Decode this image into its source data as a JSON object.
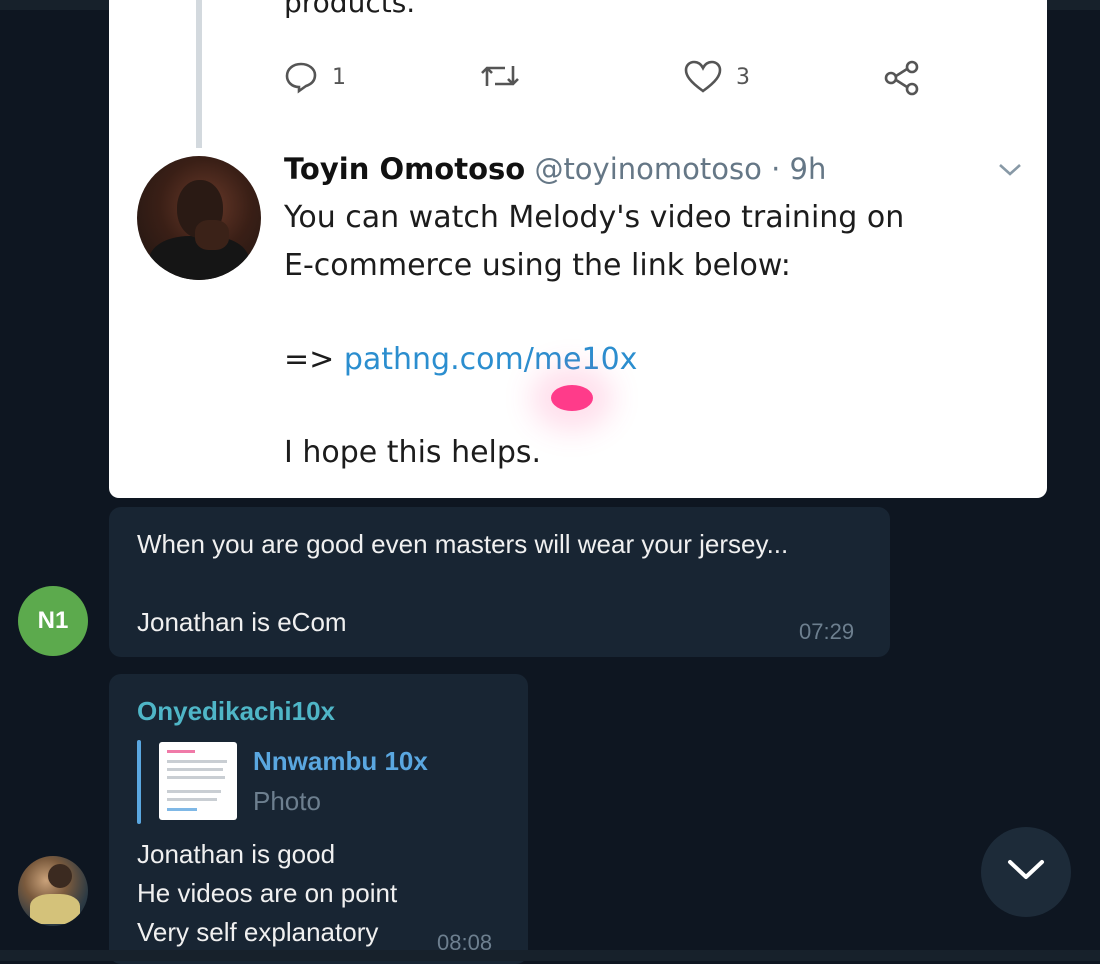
{
  "tweet": {
    "prev_text_partial": "products.",
    "replies_count": "1",
    "likes_count": "3",
    "author_name": "Toyin Omotoso",
    "author_handle": "@toyinomotoso",
    "time_ago": "· 9h",
    "text_line1": "You can watch Melody's video training on",
    "text_line2": "E-commerce using the link below:",
    "arrow": "=>",
    "link": "pathng.com/me10x",
    "closing": "I hope this helps."
  },
  "messages": [
    {
      "avatar_initials": "N1",
      "avatar_color": "#5caa4d",
      "lines": [
        "When you are good even masters will wear your jersey...",
        "Jonathan is eCom"
      ],
      "time": "07:29"
    },
    {
      "sender": "Onyedikachi10x",
      "sender_color": "#4fb6c7",
      "reply_to": {
        "name": "Nnwambu 10x",
        "type": "Photo"
      },
      "lines": [
        "Jonathan is good",
        "He videos are on point",
        "Very self explanatory"
      ],
      "time": "08:08"
    }
  ],
  "colors": {
    "background": "#0e1621",
    "bubble": "#182533",
    "link": "#2b8ecf",
    "accent": "#5aa7e0"
  },
  "icons": [
    "reply-icon",
    "retweet-icon",
    "like-icon",
    "share-icon",
    "chevron-down-icon",
    "scroll-down-icon"
  ]
}
